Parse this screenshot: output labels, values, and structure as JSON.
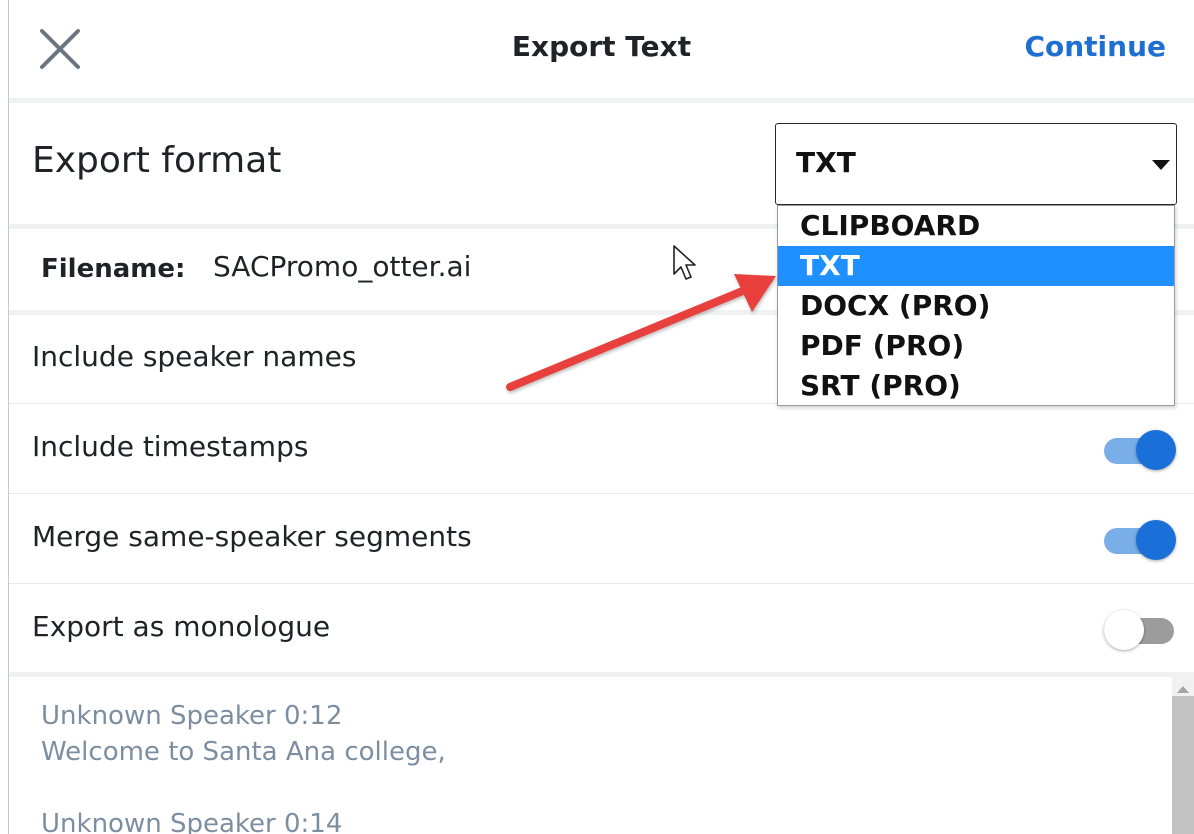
{
  "header": {
    "title": "Export Text",
    "continue_label": "Continue",
    "close_icon": "close-icon"
  },
  "export_format": {
    "label": "Export format",
    "selected": "TXT",
    "options": [
      "CLIPBOARD",
      "TXT",
      "DOCX (PRO)",
      "PDF (PRO)",
      "SRT (PRO)"
    ],
    "highlight_color": "#1e90ff"
  },
  "filename": {
    "key": "Filename:",
    "value": "SACPromo_otter.ai"
  },
  "options": {
    "include_speaker_names": {
      "label": "Include speaker names"
    },
    "include_timestamps": {
      "label": "Include timestamps",
      "on": true
    },
    "merge_segments": {
      "label": "Merge same-speaker segments",
      "on": true
    },
    "export_monologue": {
      "label": "Export as monologue",
      "on": false
    }
  },
  "preview": {
    "entries": [
      {
        "speaker": "Unknown Speaker  0:12",
        "text": "Welcome to Santa Ana college,"
      },
      {
        "speaker": "Unknown Speaker  0:14",
        "text": ""
      }
    ]
  },
  "colors": {
    "accent": "#1f6fd0",
    "toggle_on": "#1a6fd8",
    "annotation_arrow": "#e8413c",
    "preview_text": "#7d8ea1"
  }
}
